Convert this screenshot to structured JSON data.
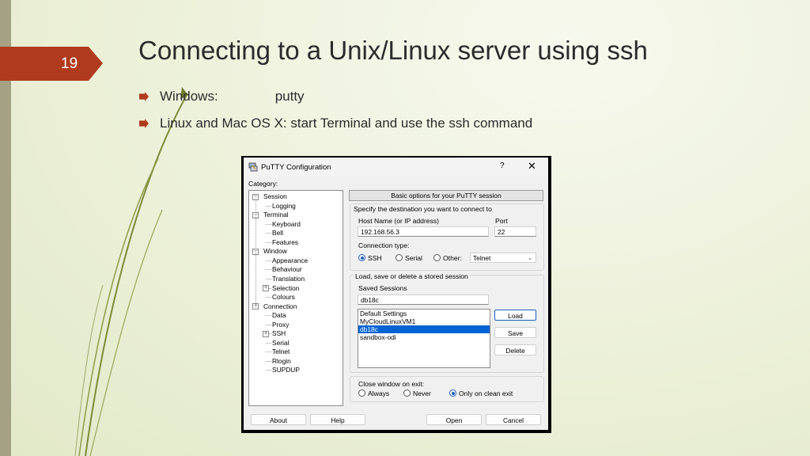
{
  "slide": {
    "number": "19",
    "title": "Connecting to a Unix/Linux server using ssh",
    "bullets": [
      {
        "label": "Windows:",
        "value": "putty"
      },
      {
        "text": "Linux and Mac OS X:  start Terminal and use the ssh command"
      }
    ],
    "colors": {
      "accent": "#b03a1d",
      "background": "#eef2dc"
    }
  },
  "putty": {
    "window_title": "PuTTY Configuration",
    "help_button": "?",
    "close_button": "✕",
    "category_label": "Category:",
    "tree": [
      {
        "label": "Session",
        "level": 0,
        "toggle": "−"
      },
      {
        "label": "Logging",
        "level": 1
      },
      {
        "label": "Terminal",
        "level": 0,
        "toggle": "−"
      },
      {
        "label": "Keyboard",
        "level": 1
      },
      {
        "label": "Bell",
        "level": 1
      },
      {
        "label": "Features",
        "level": 1
      },
      {
        "label": "Window",
        "level": 0,
        "toggle": "−"
      },
      {
        "label": "Appearance",
        "level": 1
      },
      {
        "label": "Behaviour",
        "level": 1
      },
      {
        "label": "Translation",
        "level": 1
      },
      {
        "label": "Selection",
        "level": 1,
        "toggle": "+"
      },
      {
        "label": "Colours",
        "level": 1
      },
      {
        "label": "Connection",
        "level": 0,
        "toggle": "−"
      },
      {
        "label": "Data",
        "level": 1
      },
      {
        "label": "Proxy",
        "level": 1
      },
      {
        "label": "SSH",
        "level": 1,
        "toggle": "+"
      },
      {
        "label": "Serial",
        "level": 1
      },
      {
        "label": "Telnet",
        "level": 1
      },
      {
        "label": "Rlogin",
        "level": 1
      },
      {
        "label": "SUPDUP",
        "level": 1
      }
    ],
    "panel_header": "Basic options for your PuTTY session",
    "destination_group": "Specify the destination you want to connect to",
    "host_label": "Host Name (or IP address)",
    "host_value": "192.168.56.3",
    "port_label": "Port",
    "port_value": "22",
    "conn_type_label": "Connection type:",
    "conn_types": {
      "ssh": "SSH",
      "serial": "Serial",
      "other": "Other:"
    },
    "conn_selected": "SSH",
    "other_select_value": "Telnet",
    "sessions_group": "Load, save or delete a stored session",
    "saved_sessions_label": "Saved Sessions",
    "saved_sessions_value": "db18c",
    "sessions": [
      "Default Settings",
      "MyCloudLinuxVM1",
      "db18c",
      "sandbox-odi"
    ],
    "selected_session": "db18c",
    "load_button": "Load",
    "save_button": "Save",
    "delete_button": "Delete",
    "close_exit_label": "Close window on exit:",
    "exit_options": {
      "always": "Always",
      "never": "Never",
      "clean": "Only on clean exit"
    },
    "exit_selected": "Only on clean exit",
    "about_button": "About",
    "help_bottom_button": "Help",
    "open_button": "Open",
    "cancel_button": "Cancel"
  }
}
